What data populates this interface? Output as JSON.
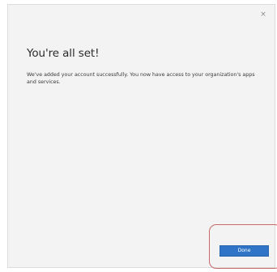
{
  "dialog": {
    "close_glyph": "×",
    "heading": "You're all set!",
    "message": "We've added your account successfully. You now have access to your organization's apps and services.",
    "done_label": "Done"
  },
  "icons": {
    "close": "close-icon"
  },
  "colors": {
    "background": "#f3f3f3",
    "primary_button": "#2f74c6",
    "highlight_outline": "#c96a6a"
  }
}
